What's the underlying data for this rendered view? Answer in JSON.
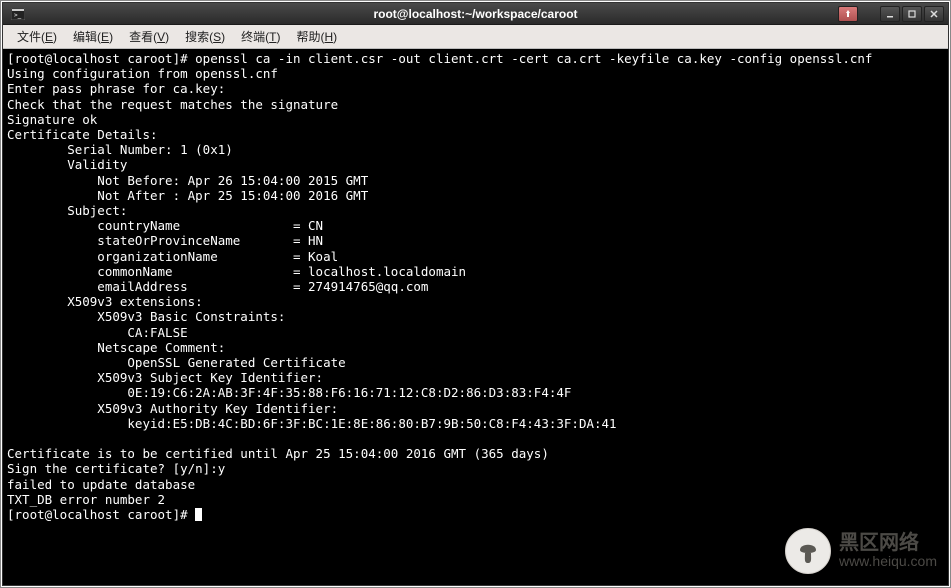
{
  "window": {
    "title": "root@localhost:~/workspace/caroot"
  },
  "menubar": {
    "items": [
      {
        "label": "文件",
        "accel": "E"
      },
      {
        "label": "编辑",
        "accel": "E"
      },
      {
        "label": "查看",
        "accel": "V"
      },
      {
        "label": "搜索",
        "accel": "S"
      },
      {
        "label": "终端",
        "accel": "T"
      },
      {
        "label": "帮助",
        "accel": "H"
      }
    ]
  },
  "terminal": {
    "prompt1": "[root@localhost caroot]# ",
    "command": "openssl ca -in client.csr -out client.crt -cert ca.crt -keyfile ca.key -config openssl.cnf",
    "output": "Using configuration from openssl.cnf\nEnter pass phrase for ca.key:\nCheck that the request matches the signature\nSignature ok\nCertificate Details:\n        Serial Number: 1 (0x1)\n        Validity\n            Not Before: Apr 26 15:04:00 2015 GMT\n            Not After : Apr 25 15:04:00 2016 GMT\n        Subject:\n            countryName               = CN\n            stateOrProvinceName       = HN\n            organizationName          = Koal\n            commonName                = localhost.localdomain\n            emailAddress              = 274914765@qq.com\n        X509v3 extensions:\n            X509v3 Basic Constraints: \n                CA:FALSE\n            Netscape Comment: \n                OpenSSL Generated Certificate\n            X509v3 Subject Key Identifier: \n                0E:19:C6:2A:AB:3F:4F:35:88:F6:16:71:12:C8:D2:86:D3:83:F4:4F\n            X509v3 Authority Key Identifier: \n                keyid:E5:DB:4C:BD:6F:3F:BC:1E:8E:86:80:B7:9B:50:C8:F4:43:3F:DA:41\n\nCertificate is to be certified until Apr 25 15:04:00 2016 GMT (365 days)\nSign the certificate? [y/n]:y\nfailed to update database\nTXT_DB error number 2",
    "prompt2": "[root@localhost caroot]# "
  },
  "watermark": {
    "line1": "黑区网络",
    "line2": "www.heiqu.com"
  }
}
